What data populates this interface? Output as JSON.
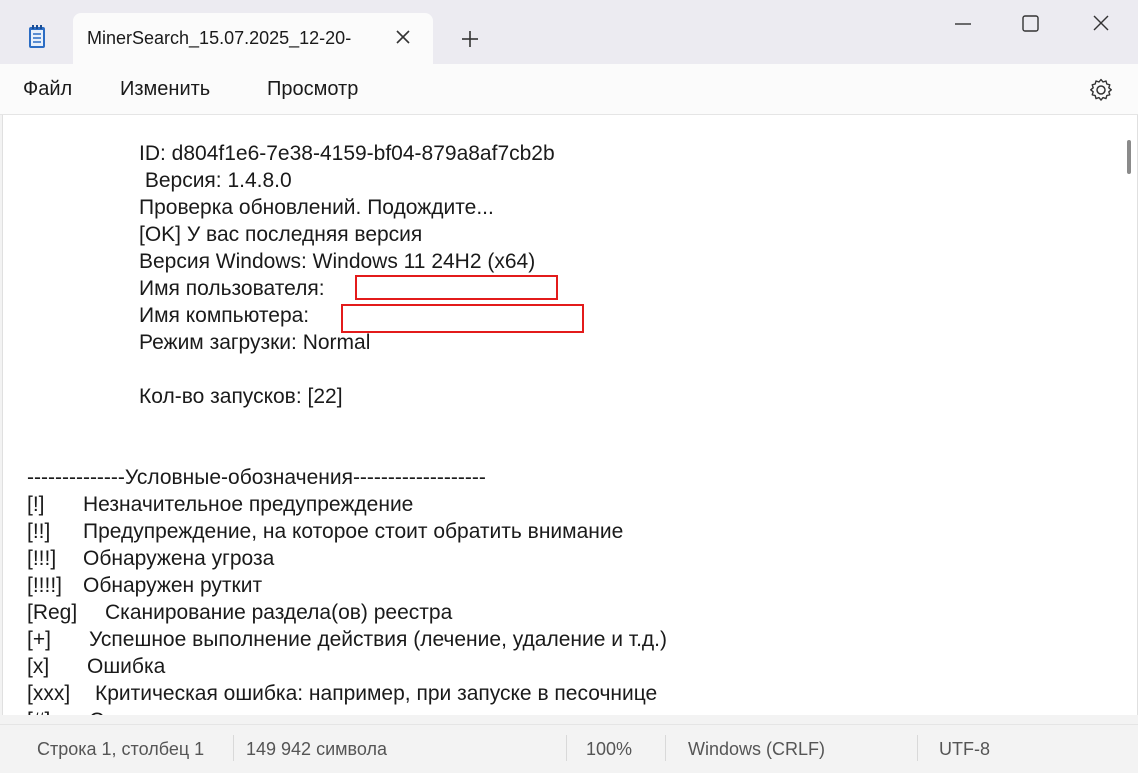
{
  "window": {
    "tab_title": "MinerSearch_15.07.2025_12-20-",
    "new_tab_icon": "plus-icon",
    "close_tab_icon": "close-icon",
    "controls": [
      "minimize-icon",
      "maximize-icon",
      "close-window-icon"
    ]
  },
  "menu": {
    "file": "Файл",
    "edit": "Изменить",
    "view": "Просмотр",
    "settings_icon": "gear-icon"
  },
  "document": {
    "lines": [
      "ID: d804f1e6-7e38-4159-bf04-879a8af7cb2b",
      " Версия: 1.4.8.0",
      "Проверка обновлений. Подождите...",
      "[OK] У вас последняя версия",
      "Версия Windows: Windows 11 24H2 (x64)",
      "Имя пользователя:",
      "Имя компьютера:",
      "Режим загрузки: Normal",
      "Кол-во запусков: [22]",
      "--------------Условные-обозначения-------------------"
    ],
    "legend": [
      {
        "code": "[!]",
        "text": "Незначительное предупреждение"
      },
      {
        "code": "[!!]",
        "text": "Предупреждение, на которое стоит обратить внимание"
      },
      {
        "code": "[!!!]",
        "text": "Обнаружена угроза"
      },
      {
        "code": "[!!!!]",
        "text": "Обнаружен руткит"
      },
      {
        "code": "[Reg]",
        "text": "Сканирование раздела(ов) реестра"
      },
      {
        "code": "[+]",
        "text": "Успешное выполнение действия (лечение, удаление и т.д.)"
      },
      {
        "code": "[x]",
        "text": "Ошибка"
      },
      {
        "code": "[xxx]",
        "text": "Критическая ошибка: например, при запуске в песочнице"
      },
      {
        "code": "[#]",
        "text": "Статус"
      }
    ]
  },
  "status": {
    "position": "Строка 1, столбец 1",
    "chars": "149 942 символа",
    "zoom": "100%",
    "line_ending": "Windows (CRLF)",
    "encoding": "UTF-8"
  },
  "colors": {
    "redaction": "#e31b1b",
    "titlebar": "#ecebf1"
  }
}
